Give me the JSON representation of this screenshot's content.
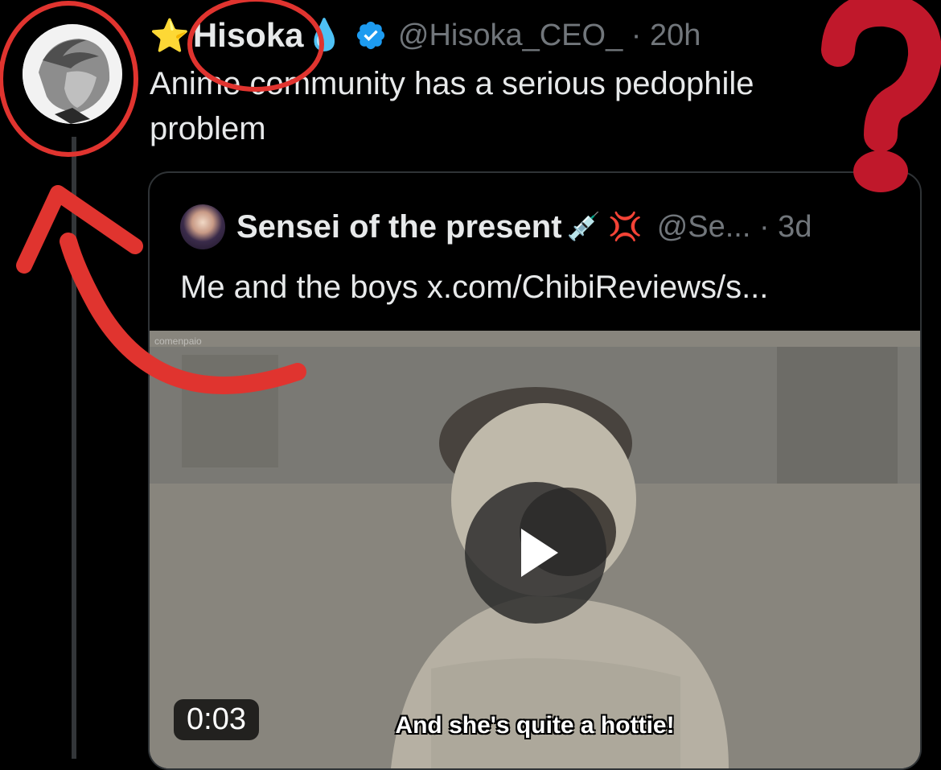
{
  "tweet": {
    "author": {
      "star_emoji": "⭐",
      "display_name": "Hisoka",
      "drop_emoji": "💧",
      "handle_time": "@Hisoka_CEO_ · 20h"
    },
    "text": "Anime community has a serious pedophile problem"
  },
  "quoted_tweet": {
    "display_name": "Sensei of the present",
    "emoji": "💉 💢",
    "handle_time": "@Se... · 3d",
    "text": "Me and the boys x.com/ChibiReviews/s...",
    "media": {
      "watermark": "comenpaio",
      "duration": "0:03",
      "subtitle": "And she's quite a hottie!"
    }
  },
  "colors": {
    "background": "#000000",
    "primary_text": "#e7e9ea",
    "secondary_text": "#71767b",
    "verified_blue": "#1d9bf0",
    "annotation_red": "#e0342f",
    "question_mark_red": "#c0182b"
  },
  "icons": [
    "verified-badge-icon",
    "play-icon",
    "question-mark-annotation",
    "curved-arrow-annotation"
  ]
}
